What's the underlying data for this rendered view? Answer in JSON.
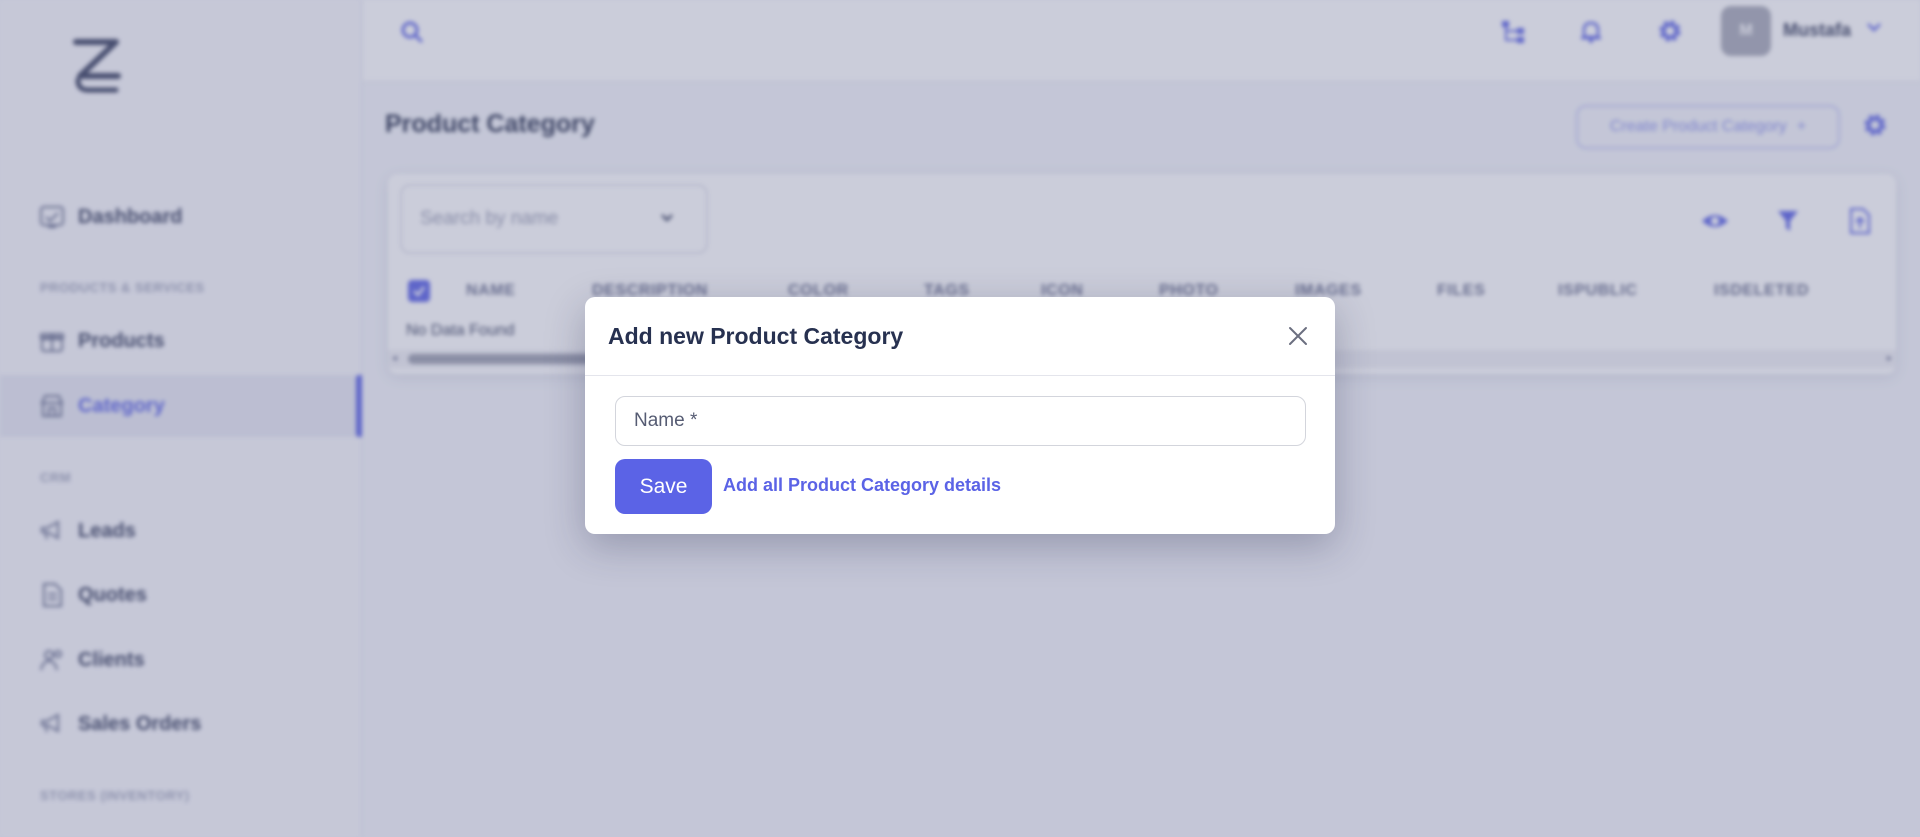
{
  "user": {
    "name": "Mustafa",
    "avatar_initial": "M"
  },
  "sidebar": {
    "items": [
      {
        "label": "Dashboard",
        "icon": "dashboard-icon"
      },
      {
        "label": "Products",
        "icon": "gift-box-icon"
      },
      {
        "label": "Category",
        "icon": "store-icon",
        "active": true
      },
      {
        "label": "Leads",
        "icon": "megaphone-icon"
      },
      {
        "label": "Quotes",
        "icon": "document-icon"
      },
      {
        "label": "Clients",
        "icon": "users-icon"
      },
      {
        "label": "Sales Orders",
        "icon": "megaphone-icon"
      }
    ],
    "sections": [
      "PRODUCTS & SERVICES",
      "CRM",
      "STORES (INVENTORY)"
    ]
  },
  "header": {
    "icons": [
      "search-icon",
      "hierarchy-icon",
      "bell-icon",
      "gear-icon",
      "chevron-down-icon"
    ]
  },
  "page": {
    "title": "Product Category",
    "create_button": "Create Product Category",
    "create_button_icon": "+"
  },
  "table": {
    "search_placeholder": "Search by name",
    "columns": [
      "NAME",
      "DESCRIPTION",
      "COLOR",
      "TAGS",
      "ICON",
      "PHOTO",
      "IMAGES",
      "FILES",
      "ISPUBLIC",
      "ISDELETED"
    ],
    "empty_text": "No Data Found"
  },
  "modal": {
    "title": "Add new Product Category",
    "name_placeholder": "Name *",
    "name_value": "",
    "save_label": "Save",
    "details_link": "Add all Product Category details"
  },
  "colors": {
    "accent": "#5b63e6",
    "overlay": "#686c94",
    "text_dark": "#273150"
  }
}
